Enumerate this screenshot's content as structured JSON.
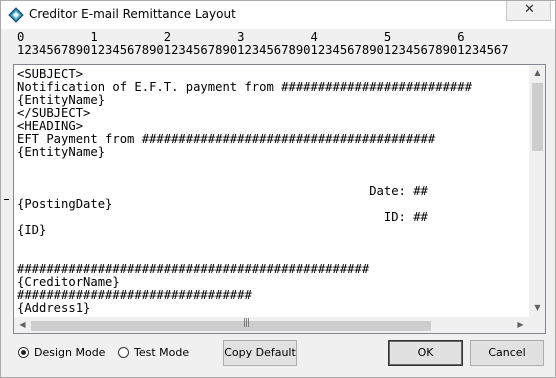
{
  "window": {
    "title": "Creditor E-mail Remittance Layout",
    "close_glyph": "✕",
    "app_icon": "diamond-app-icon",
    "close_icon": "close-icon"
  },
  "ruler": {
    "tens": "0         1         2         3         4         5         6",
    "units": "1234567890123456789012345678901234567890123456789012345678901234567"
  },
  "editor": {
    "lines": [
      "<SUBJECT>",
      "Notification of E.F.T. payment from ##########################",
      "{EntityName}",
      "</SUBJECT>",
      "<HEADING>",
      "EFT Payment from ########################################",
      "{EntityName}",
      "",
      "",
      "                                                Date: ##",
      "{PostingDate}",
      "                                                  ID: ##",
      "{ID}",
      "",
      "",
      "################################################",
      "{CreditorName}",
      "################################",
      "{Address1}"
    ],
    "vscroll_up_glyph": "▲",
    "vscroll_down_glyph": "▼",
    "hscroll_left_glyph": "◀",
    "hscroll_right_glyph": "▶",
    "hscroll_grip": "|||"
  },
  "mode": {
    "design_label": "Design Mode",
    "test_label": "Test Mode",
    "selected": "design"
  },
  "buttons": {
    "copy_default": "Copy Default",
    "ok": "OK",
    "cancel": "Cancel"
  }
}
